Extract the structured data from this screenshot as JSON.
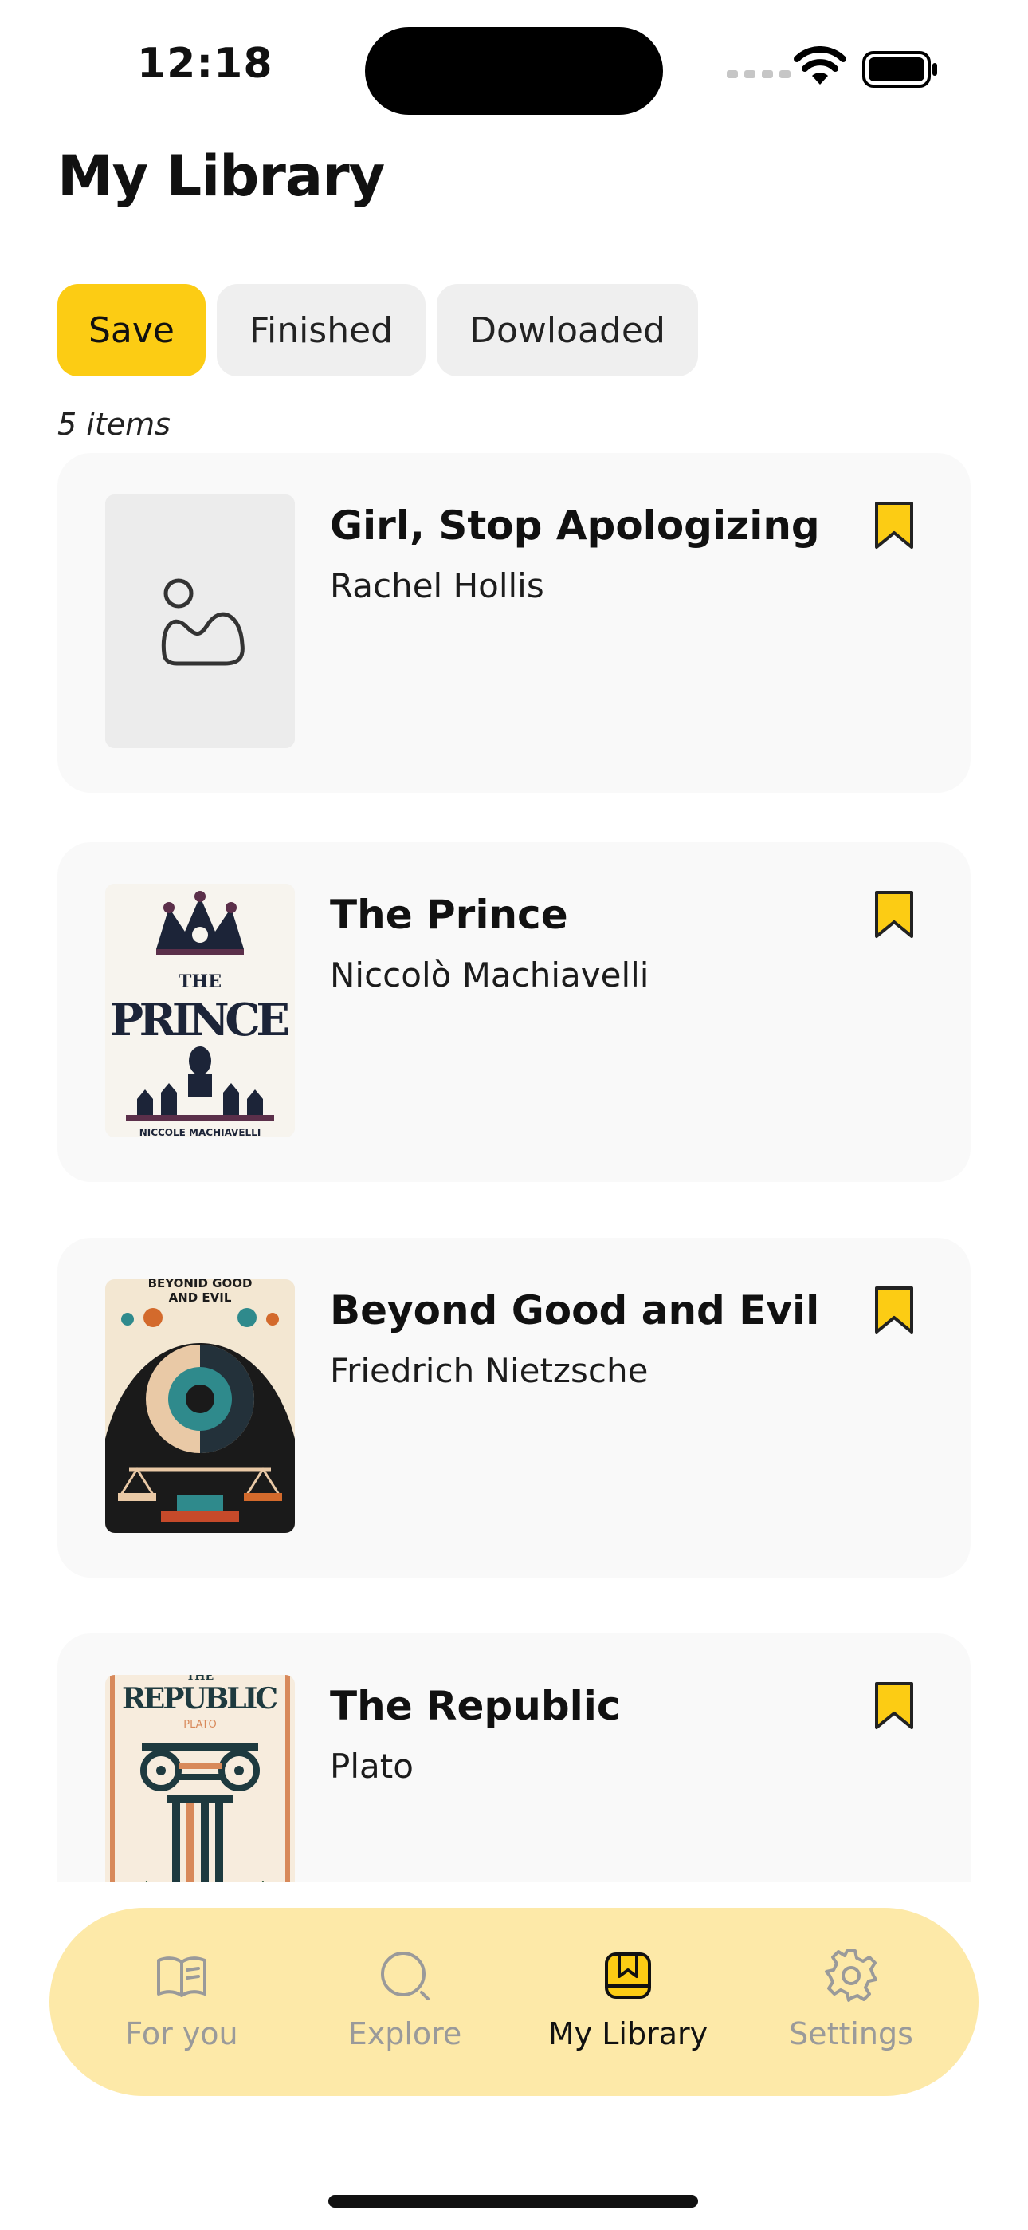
{
  "status_bar": {
    "time": "12:18"
  },
  "header": {
    "title": "My Library"
  },
  "tabs": [
    {
      "label": "Save",
      "active": true
    },
    {
      "label": "Finished",
      "active": false
    },
    {
      "label": "Dowloaded",
      "active": false
    }
  ],
  "items_count": "5 items",
  "books": [
    {
      "title": "Girl, Stop Apologizing",
      "author": "Rachel Hollis",
      "cover": "placeholder-image-icon",
      "saved": true
    },
    {
      "title": "The Prince",
      "author": "Niccolò Machiavelli",
      "cover_text": "THE PRINCE",
      "cover_subtext": "NICCOLE MACHIAVELLI",
      "saved": true
    },
    {
      "title": "Beyond Good and Evil",
      "author": "Friedrich Nietzsche",
      "cover_text": "BEYONID GOOD AND EVIL",
      "saved": true
    },
    {
      "title": "The Republic",
      "author": "Plato",
      "cover_text": "REPUBLIC",
      "cover_top_text": "THE",
      "cover_subtext": "PLATO",
      "saved": true
    }
  ],
  "nav": [
    {
      "label": "For you",
      "icon": "book-open-icon",
      "active": false
    },
    {
      "label": "Explore",
      "icon": "search-icon",
      "active": false
    },
    {
      "label": "My Library",
      "icon": "library-bookmark-icon",
      "active": true
    },
    {
      "label": "Settings",
      "icon": "gear-icon",
      "active": false
    }
  ],
  "colors": {
    "accent": "#fccc14",
    "nav_background": "#fde9a8",
    "card_background": "#f9f9f9"
  }
}
